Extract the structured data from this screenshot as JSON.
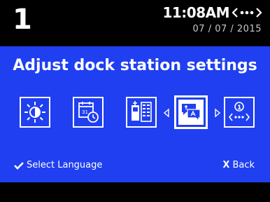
{
  "status": {
    "screen_number": "1",
    "time": "11:08AM",
    "date": "07 / 07 / 2015"
  },
  "panel": {
    "title": "Adjust dock station settings",
    "background_color": "#1f3ff0"
  },
  "icons": [
    {
      "name": "brightness-icon"
    },
    {
      "name": "date-time-icon"
    },
    {
      "name": "dock-keypad-icon"
    },
    {
      "name": "language-icon",
      "selected": true
    },
    {
      "name": "connection-settings-icon"
    }
  ],
  "footer": {
    "select_label": "Select Language",
    "back_label": "Back",
    "back_symbol": "X"
  }
}
